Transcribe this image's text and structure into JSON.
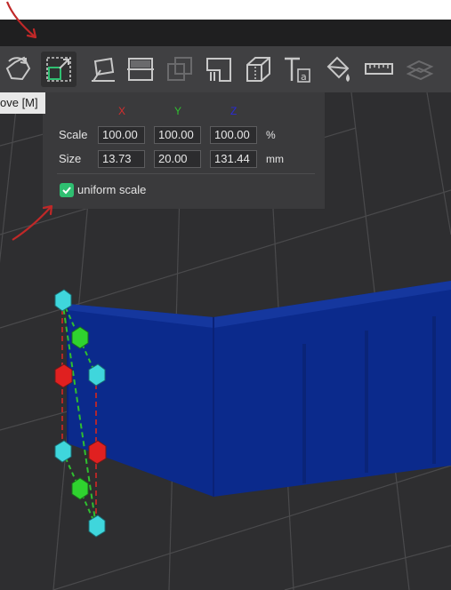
{
  "tooltip": {
    "text": "ove [M]"
  },
  "toolbar": {
    "tools": [
      {
        "icon": "rotate-icon"
      },
      {
        "icon": "scale-icon",
        "active": true
      },
      {
        "icon": "lay-on-face-icon"
      },
      {
        "icon": "cut-icon"
      },
      {
        "icon": "boolean-icon"
      },
      {
        "icon": "support-painting-icon"
      },
      {
        "icon": "seam-painting-icon"
      },
      {
        "icon": "text-icon"
      },
      {
        "icon": "color-painting-icon"
      },
      {
        "icon": "measure-icon"
      },
      {
        "icon": "assembly-icon"
      }
    ]
  },
  "scale_panel": {
    "axes": {
      "x": "X",
      "y": "Y",
      "z": "Z"
    },
    "axis_colors": {
      "x": "#d42e2e",
      "y": "#2fbf2f",
      "z": "#2a2ad8"
    },
    "scale": {
      "label": "Scale",
      "x": "100.00",
      "y": "100.00",
      "z": "100.00",
      "unit": "%"
    },
    "size": {
      "label": "Size",
      "x": "13.73",
      "y": "20.00",
      "z": "131.44",
      "unit": "mm"
    },
    "uniform_scale": {
      "label": "uniform scale",
      "checked": true
    }
  },
  "colors": {
    "model": "#0d2a8c",
    "annotation": "#c02828"
  }
}
